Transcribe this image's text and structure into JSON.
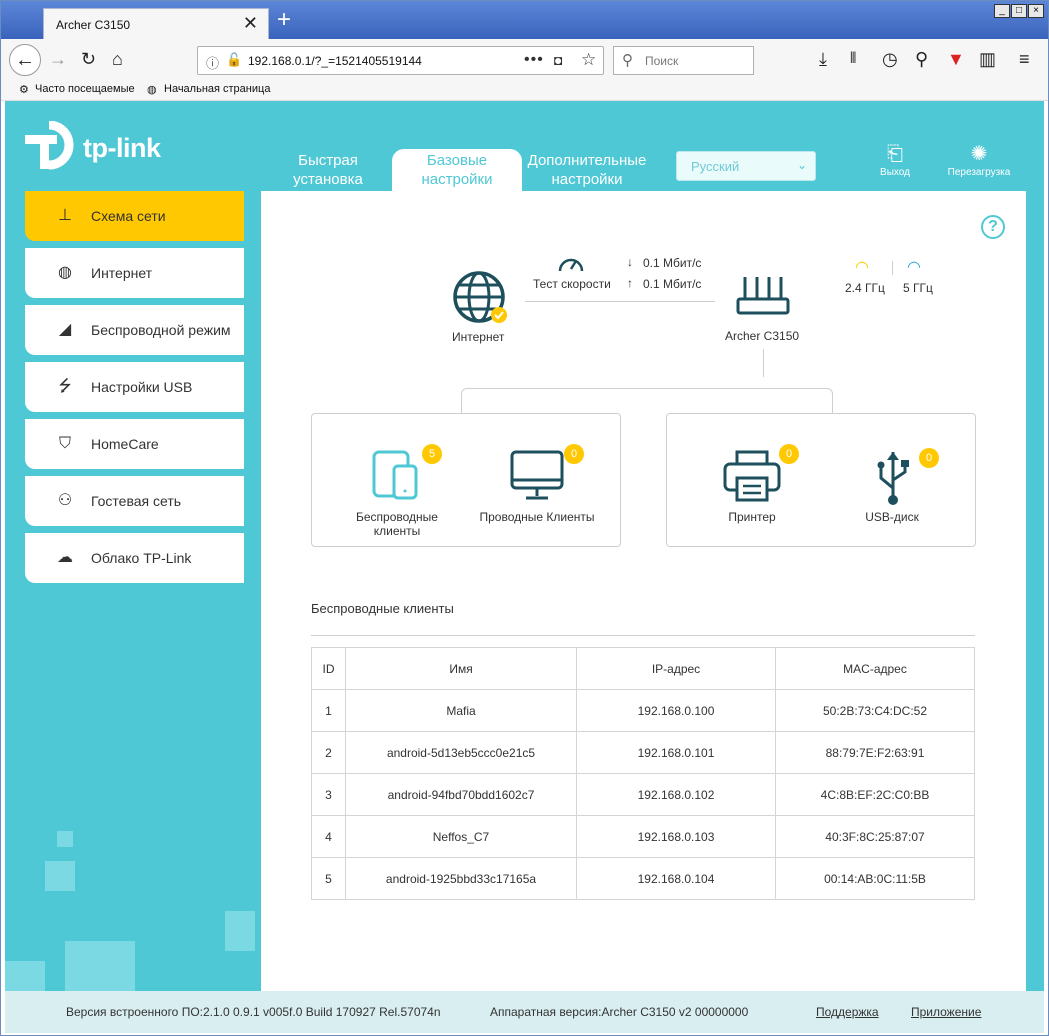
{
  "browser": {
    "tab_title": "Archer C3150",
    "tab_close": "✕",
    "new_tab": "+",
    "url": "192.168.0.1/?_=1521405519144",
    "search_placeholder": "Поиск",
    "bookmarks": [
      "Часто посещаемые",
      "Начальная страница"
    ]
  },
  "router": {
    "logo_text": "tp-link",
    "top_tabs": [
      "Быстрая установка",
      "Базовые настройки",
      "Дополнительные настройки"
    ],
    "language": "Русский",
    "logout": "Выход",
    "reboot": "Перезагрузка",
    "sidebar": [
      {
        "label": "Схема сети",
        "icon": "network-map-icon"
      },
      {
        "label": "Интернет",
        "icon": "globe-icon"
      },
      {
        "label": "Беспроводной режим",
        "icon": "wifi-icon"
      },
      {
        "label": "Настройки USB",
        "icon": "usb-icon"
      },
      {
        "label": "HomeCare",
        "icon": "shield-icon"
      },
      {
        "label": "Гостевая сеть",
        "icon": "guests-icon"
      },
      {
        "label": "Облако TP-Link",
        "icon": "cloud-icon"
      }
    ],
    "map": {
      "internet": "Интернет",
      "speed_test": "Тест скорости",
      "download": "0.1  Мбит/с",
      "upload": "0.1  Мбит/с",
      "router": "Archer C3150",
      "band_24": "2.4 ГГц",
      "band_5": "5 ГГц"
    },
    "clients": {
      "wireless_label": "Беспроводные клиенты",
      "wireless_count": "5",
      "wired_label": "Проводные Клиенты",
      "wired_count": "0",
      "printer_label": "Принтер",
      "printer_count": "0",
      "usb_label": "USB-диск",
      "usb_count": "0"
    },
    "table": {
      "title": "Беспроводные клиенты",
      "headers": [
        "ID",
        "Имя",
        "IP-адрес",
        "MAC-адрес"
      ],
      "rows": [
        [
          "1",
          "Mafia",
          "192.168.0.100",
          "50:2B:73:C4:DC:52"
        ],
        [
          "2",
          "android-5d13eb5ccc0e21c5",
          "192.168.0.101",
          "88:79:7E:F2:63:91"
        ],
        [
          "3",
          "android-94fbd70bdd1602c7",
          "192.168.0.102",
          "4C:8B:EF:2C:C0:BB"
        ],
        [
          "4",
          "Neffos_C7",
          "192.168.0.103",
          "40:3F:8C:25:87:07"
        ],
        [
          "5",
          "android-1925bbd33c17165a",
          "192.168.0.104",
          "00:14:AB:0C:11:5B"
        ]
      ]
    },
    "footer": {
      "firmware": "Версия встроенного ПО:2.1.0 0.9.1 v005f.0 Build 170927 Rel.57074n",
      "hardware": "Аппаратная версия:Archer C3150 v2 00000000",
      "support": "Поддержка",
      "app": "Приложение"
    }
  }
}
